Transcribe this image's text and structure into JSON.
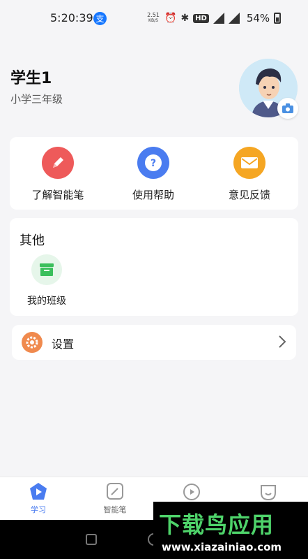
{
  "status_bar": {
    "time": "5:20:39",
    "netspeed_value": "2.51",
    "netspeed_unit": "KB/S",
    "hd": "HD",
    "battery": "54%"
  },
  "profile": {
    "name": "学生1",
    "grade": "小学三年级"
  },
  "actions": [
    {
      "label": "了解智能笔",
      "icon": "pencil-icon",
      "color": "#ee5a5a"
    },
    {
      "label": "使用帮助",
      "icon": "help-icon",
      "color": "#4a7cf0"
    },
    {
      "label": "意见反馈",
      "icon": "mail-icon",
      "color": "#f5a623"
    }
  ],
  "other": {
    "title": "其他",
    "items": [
      {
        "label": "我的班级",
        "icon": "class-box-icon",
        "color": "#3bbf5c"
      }
    ]
  },
  "settings": {
    "label": "设置",
    "icon": "gear-icon",
    "color": "#f08a4e"
  },
  "bottom_nav": {
    "active_color": "#4a7cf0",
    "items": [
      {
        "label": "学习",
        "icon": "study-icon",
        "active": true
      },
      {
        "label": "智能笔",
        "icon": "smart-pen-icon",
        "active": false
      },
      {
        "label": "",
        "icon": "play-icon",
        "active": false
      },
      {
        "label": "",
        "icon": "face-icon",
        "active": false
      }
    ]
  },
  "watermark": {
    "title": "下载鸟应用",
    "url": "www.xiazainiao.com"
  }
}
